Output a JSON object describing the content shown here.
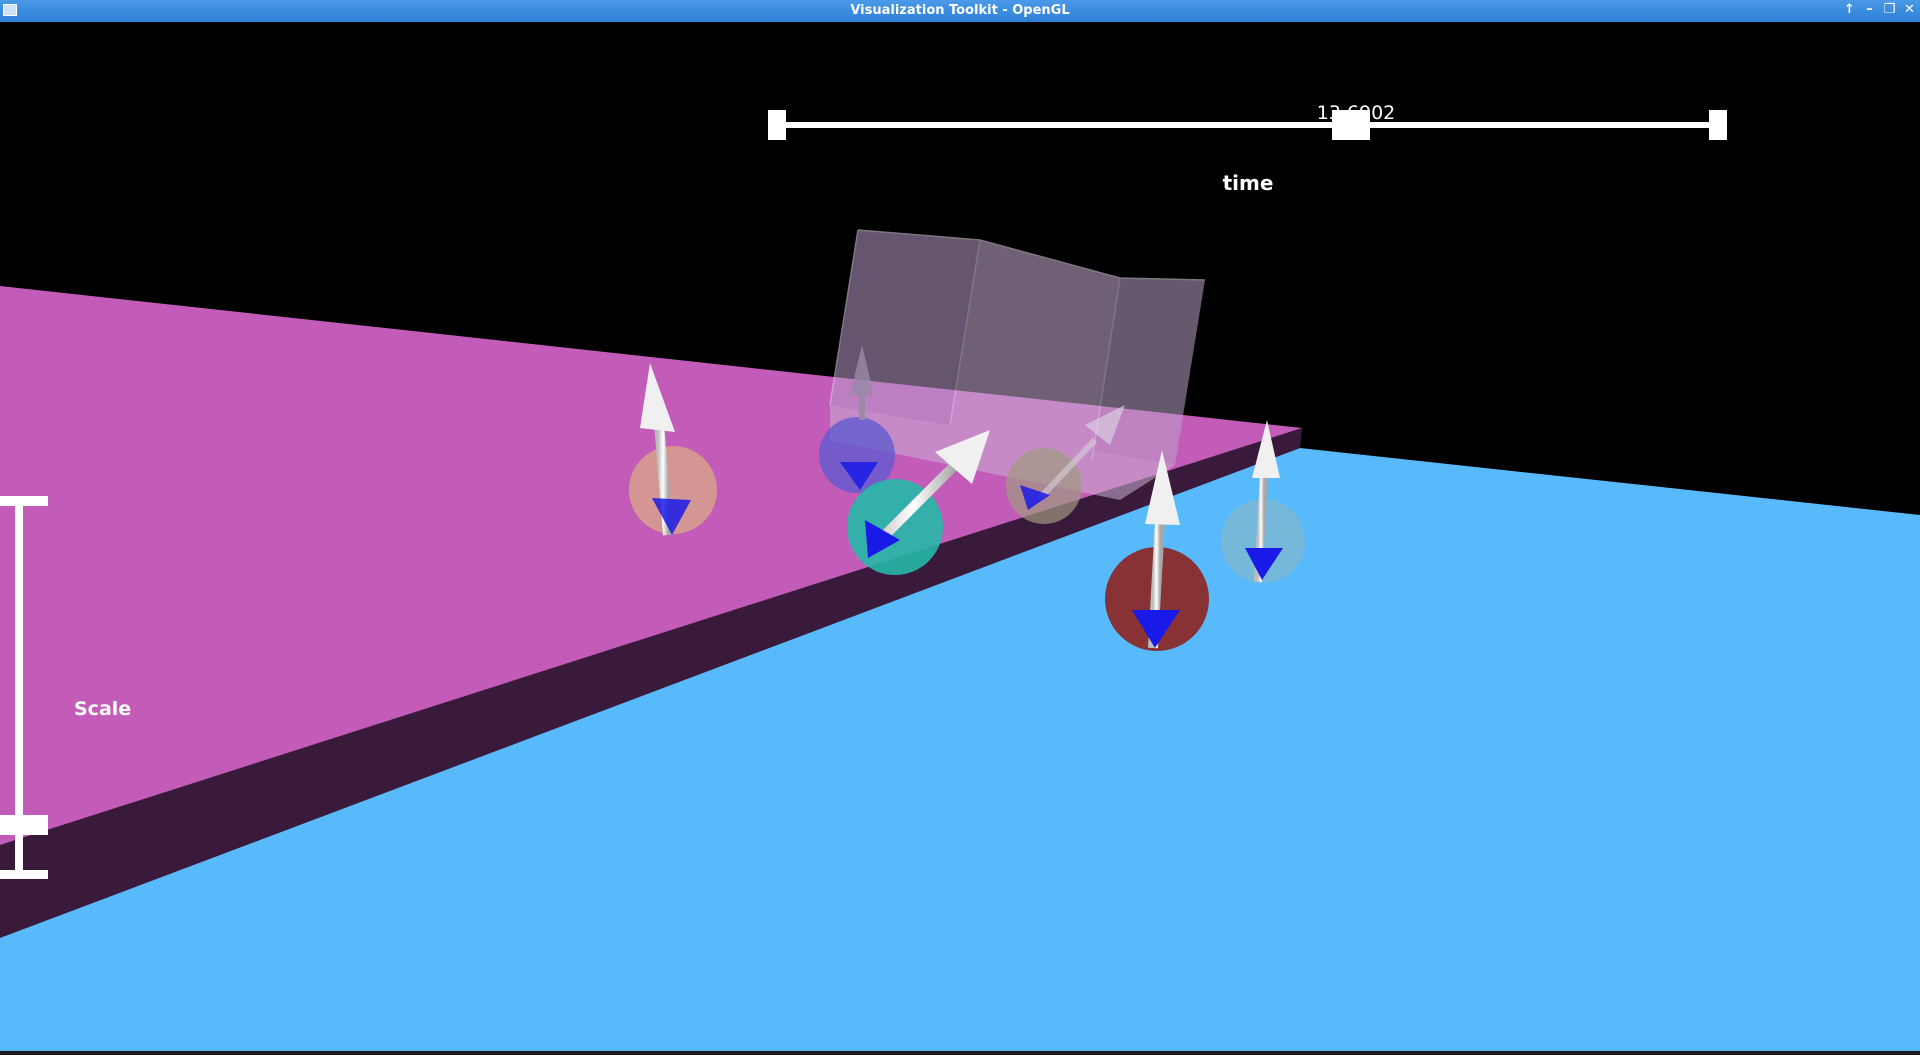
{
  "window": {
    "title": "Visualization Toolkit - OpenGL",
    "controls": [
      "↑",
      "–",
      "❐",
      "✕"
    ]
  },
  "slider": {
    "value_text": "13.6902",
    "label": "time",
    "value_fraction": 0.61
  },
  "scale_widget": {
    "label": "Scale"
  },
  "colors": {
    "ground": "#58b9fb",
    "ramp": "#c35cb8",
    "ramp_side": "#3a1a3a",
    "box": "#b89cc9",
    "arrow": "#ffffff",
    "cone": "#1a1ae8",
    "spheres": [
      "#d7a08c",
      "#5a5ad0",
      "#26b8a8",
      "#a09a80",
      "#8b2a2a",
      "#7ab8d6"
    ]
  }
}
